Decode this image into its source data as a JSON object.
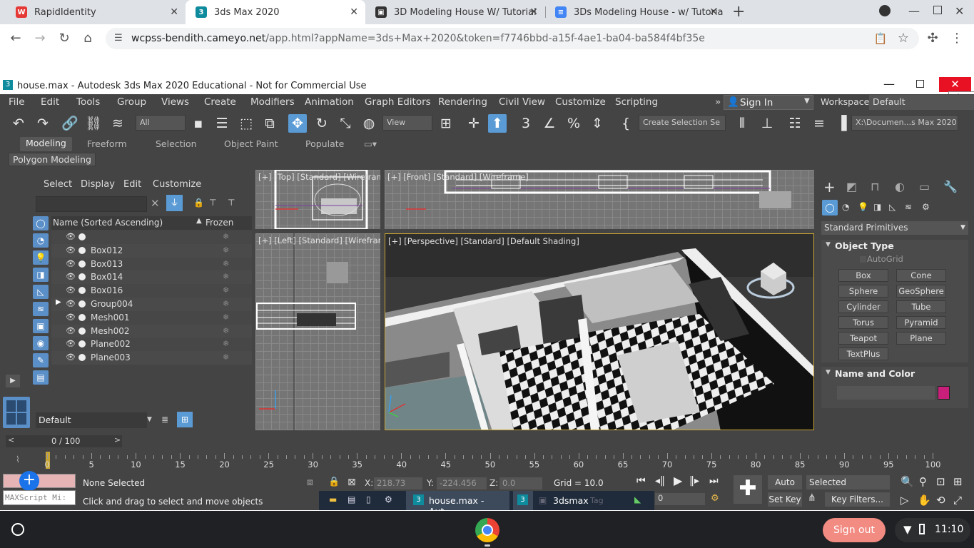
{
  "browser": {
    "tabs": [
      {
        "label": "RapidIdentity",
        "favicon_color": "#e53935"
      },
      {
        "label": "3ds Max 2020",
        "favicon_color": "#0f8b9e"
      },
      {
        "label": "3D Modeling House W/ Tutorial",
        "favicon_color": "#333333"
      },
      {
        "label": "3Ds Modeling House - w/ Tutoria",
        "favicon_color": "#4285f4"
      }
    ],
    "url_host": "wcpss-bendith.cameyo.net",
    "url_path": "/app.html?appName=3ds+Max+2020&token=f7746bbd-a15f-4ae1-ba04-ba584f4bf35e"
  },
  "window": {
    "title": "house.max - Autodesk 3ds Max 2020 Educational - Not for Commercial Use",
    "close_tooltip": "Close"
  },
  "menu": {
    "items": [
      "File",
      "Edit",
      "Tools",
      "Group",
      "Views",
      "Create",
      "Modifiers",
      "Animation",
      "Graph Editors",
      "Rendering",
      "Civil View",
      "Customize",
      "Scripting"
    ],
    "sign_in": "Sign In",
    "workspaces_label": "Workspaces:",
    "workspaces_value": "Default"
  },
  "toolbar": {
    "filter_value": "All",
    "ref_coord": "View",
    "selection_set": "Create Selection Se",
    "path_value": "X:\\Documen...s Max 2020"
  },
  "ribbon": {
    "tabs": [
      "Modeling",
      "Freeform",
      "Selection",
      "Object Paint",
      "Populate"
    ],
    "panel_label": "Polygon Modeling"
  },
  "scene_explorer": {
    "menus": [
      "Select",
      "Display",
      "Edit",
      "Customize"
    ],
    "col_name": "Name (Sorted Ascending)",
    "col_frozen": "Frozen",
    "rows": [
      {
        "name": ""
      },
      {
        "name": "Box012"
      },
      {
        "name": "Box013"
      },
      {
        "name": "Box014"
      },
      {
        "name": "Box016"
      },
      {
        "name": "Group004"
      },
      {
        "name": "Mesh001"
      },
      {
        "name": "Mesh002"
      },
      {
        "name": "Plane002"
      },
      {
        "name": "Plane003"
      }
    ],
    "layer": "Default"
  },
  "viewports": {
    "top": "[+] [Top] [Standard] [Wirefram",
    "front": "[+] [Front] [Standard] [Wireframe]",
    "left": "[+] [Left] [Standard] [Wirefram",
    "perspective": "[+] [Perspective] [Standard] [Default Shading]"
  },
  "command_panel": {
    "category": "Standard Primitives",
    "object_type_title": "Object Type",
    "autogrid": "AutoGrid",
    "buttons": [
      "Box",
      "Cone",
      "Sphere",
      "GeoSphere",
      "Cylinder",
      "Tube",
      "Torus",
      "Pyramid",
      "Teapot",
      "Plane",
      "TextPlus"
    ],
    "name_color_title": "Name and Color",
    "swatch_color": "#c8207a"
  },
  "timeline": {
    "frame_counter": "0 / 100",
    "ticks": [
      "0",
      "5",
      "10",
      "15",
      "20",
      "25",
      "30",
      "35",
      "40",
      "45",
      "50",
      "55",
      "60",
      "65",
      "70",
      "75",
      "80",
      "85",
      "90",
      "95",
      "100"
    ]
  },
  "status": {
    "script_box": "MAXScript Mi:",
    "selection": "None Selected",
    "prompt": "Click and drag to select and move objects",
    "x_label": "X:",
    "x_value": "218.73",
    "y_label": "Y:",
    "y_value": "-224.456",
    "z_label": "Z:",
    "z_value": "0.0",
    "grid": "Grid = 10.0",
    "auto_key": "Auto Key",
    "set_key": "Set Key",
    "key_mode": "Selected",
    "key_filters": "Key Filters...",
    "frame": "0"
  },
  "taskbar": {
    "item1": "house.max - Aut...",
    "item2": "3dsmax",
    "item2_tag": "Tag"
  },
  "shelf": {
    "sign_out": "Sign out",
    "time": "11:10"
  }
}
